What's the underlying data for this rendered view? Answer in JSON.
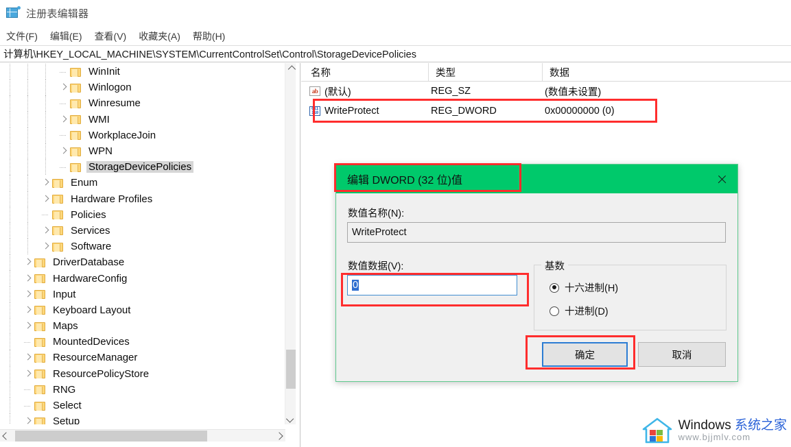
{
  "window": {
    "title": "注册表编辑器",
    "icon": "registry-editor-icon"
  },
  "menubar": {
    "items": [
      {
        "label": "文件(F)"
      },
      {
        "label": "编辑(E)"
      },
      {
        "label": "查看(V)"
      },
      {
        "label": "收藏夹(A)"
      },
      {
        "label": "帮助(H)"
      }
    ]
  },
  "address": {
    "path": "计算机\\HKEY_LOCAL_MACHINE\\SYSTEM\\CurrentControlSet\\Control\\StorageDevicePolicies"
  },
  "tree": {
    "items": [
      {
        "label": "WinInit",
        "depth": 3,
        "expandable": false,
        "selected": false
      },
      {
        "label": "Winlogon",
        "depth": 3,
        "expandable": true,
        "selected": false
      },
      {
        "label": "Winresume",
        "depth": 3,
        "expandable": false,
        "selected": false
      },
      {
        "label": "WMI",
        "depth": 3,
        "expandable": true,
        "selected": false
      },
      {
        "label": "WorkplaceJoin",
        "depth": 3,
        "expandable": false,
        "selected": false
      },
      {
        "label": "WPN",
        "depth": 3,
        "expandable": true,
        "selected": false
      },
      {
        "label": "StorageDevicePolicies",
        "depth": 3,
        "expandable": false,
        "selected": true
      },
      {
        "label": "Enum",
        "depth": 2,
        "expandable": true,
        "selected": false
      },
      {
        "label": "Hardware Profiles",
        "depth": 2,
        "expandable": true,
        "selected": false
      },
      {
        "label": "Policies",
        "depth": 2,
        "expandable": false,
        "selected": false
      },
      {
        "label": "Services",
        "depth": 2,
        "expandable": true,
        "selected": false
      },
      {
        "label": "Software",
        "depth": 2,
        "expandable": true,
        "selected": false
      },
      {
        "label": "DriverDatabase",
        "depth": 1,
        "expandable": true,
        "selected": false
      },
      {
        "label": "HardwareConfig",
        "depth": 1,
        "expandable": true,
        "selected": false
      },
      {
        "label": "Input",
        "depth": 1,
        "expandable": true,
        "selected": false
      },
      {
        "label": "Keyboard Layout",
        "depth": 1,
        "expandable": true,
        "selected": false
      },
      {
        "label": "Maps",
        "depth": 1,
        "expandable": true,
        "selected": false
      },
      {
        "label": "MountedDevices",
        "depth": 1,
        "expandable": false,
        "selected": false
      },
      {
        "label": "ResourceManager",
        "depth": 1,
        "expandable": true,
        "selected": false
      },
      {
        "label": "ResourcePolicyStore",
        "depth": 1,
        "expandable": true,
        "selected": false
      },
      {
        "label": "RNG",
        "depth": 1,
        "expandable": false,
        "selected": false
      },
      {
        "label": "Select",
        "depth": 1,
        "expandable": false,
        "selected": false
      },
      {
        "label": "Setup",
        "depth": 1,
        "expandable": true,
        "selected": false
      }
    ]
  },
  "listview": {
    "columns": [
      {
        "label": "名称"
      },
      {
        "label": "类型"
      },
      {
        "label": "数据"
      }
    ],
    "rows": [
      {
        "icon": "string-value-icon",
        "name": "(默认)",
        "type": "REG_SZ",
        "data": "(数值未设置)"
      },
      {
        "icon": "dword-value-icon",
        "name": "WriteProtect",
        "type": "REG_DWORD",
        "data": "0x00000000 (0)"
      }
    ]
  },
  "dialog": {
    "title": "编辑 DWORD (32 位)值",
    "close_label": "关闭",
    "name_label": "数值名称(N):",
    "name_value": "WriteProtect",
    "data_label": "数值数据(V):",
    "data_value": "0",
    "base_group_label": "基数",
    "radios": [
      {
        "label": "十六进制(H)",
        "checked": true
      },
      {
        "label": "十进制(D)",
        "checked": false
      }
    ],
    "ok_label": "确定",
    "cancel_label": "取消",
    "titlebar_color": "#00c96b"
  },
  "annotations": {
    "color": "#ff2d2d",
    "boxes": [
      {
        "name": "writeprotect-row-annotation"
      },
      {
        "name": "dialog-title-annotation"
      },
      {
        "name": "value-data-input-annotation"
      },
      {
        "name": "ok-button-annotation"
      }
    ]
  },
  "watermark": {
    "brand_en": "Windows ",
    "brand_cn": "系统之家",
    "url": "www.bjjmlv.com"
  }
}
